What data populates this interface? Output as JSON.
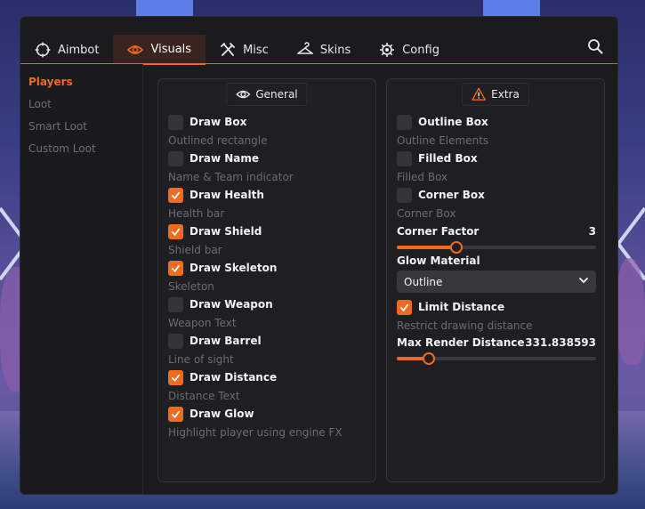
{
  "tabs": [
    {
      "label": "Aimbot",
      "icon": "crosshair-icon"
    },
    {
      "label": "Visuals",
      "icon": "eye-icon"
    },
    {
      "label": "Misc",
      "icon": "tools-icon"
    },
    {
      "label": "Skins",
      "icon": "hanger-icon"
    },
    {
      "label": "Config",
      "icon": "gear-icon"
    }
  ],
  "active_tab": "Visuals",
  "sidebar": {
    "items": [
      "Players",
      "Loot",
      "Smart Loot",
      "Custom Loot"
    ],
    "active": "Players"
  },
  "general": {
    "title": "General",
    "icon": "eye-icon",
    "options": [
      {
        "label": "Draw Box",
        "desc": "Outlined rectangle",
        "checked": false
      },
      {
        "label": "Draw Name",
        "desc": "Name & Team indicator",
        "checked": false
      },
      {
        "label": "Draw Health",
        "desc": "Health bar",
        "checked": true
      },
      {
        "label": "Draw Shield",
        "desc": "Shield bar",
        "checked": true
      },
      {
        "label": "Draw Skeleton",
        "desc": "Skeleton",
        "checked": true
      },
      {
        "label": "Draw Weapon",
        "desc": "Weapon Text",
        "checked": false
      },
      {
        "label": "Draw Barrel",
        "desc": "Line of sight",
        "checked": false
      },
      {
        "label": "Draw Distance",
        "desc": "Distance Text",
        "checked": true
      },
      {
        "label": "Draw Glow",
        "desc": "Highlight player using engine FX",
        "checked": true
      }
    ]
  },
  "extra": {
    "title": "Extra",
    "icon": "warning-icon",
    "options": [
      {
        "label": "Outline Box",
        "desc": "Outline Elements",
        "checked": false
      },
      {
        "label": "Filled Box",
        "desc": "Filled Box",
        "checked": false
      },
      {
        "label": "Corner Box",
        "desc": "Corner Box",
        "checked": false
      }
    ],
    "corner_factor": {
      "label": "Corner Factor",
      "value": "3",
      "fraction": 0.3
    },
    "glow_material": {
      "label": "Glow Material",
      "selected": "Outline"
    },
    "limit_distance": {
      "label": "Limit Distance",
      "desc": "Restrict drawing distance",
      "checked": true
    },
    "max_render_distance": {
      "label": "Max Render Distance",
      "value": "331.838593",
      "fraction": 0.16
    }
  },
  "colors": {
    "accent": "#f26a21",
    "panel": "#1f1f21",
    "window": "#1b1b1d"
  }
}
